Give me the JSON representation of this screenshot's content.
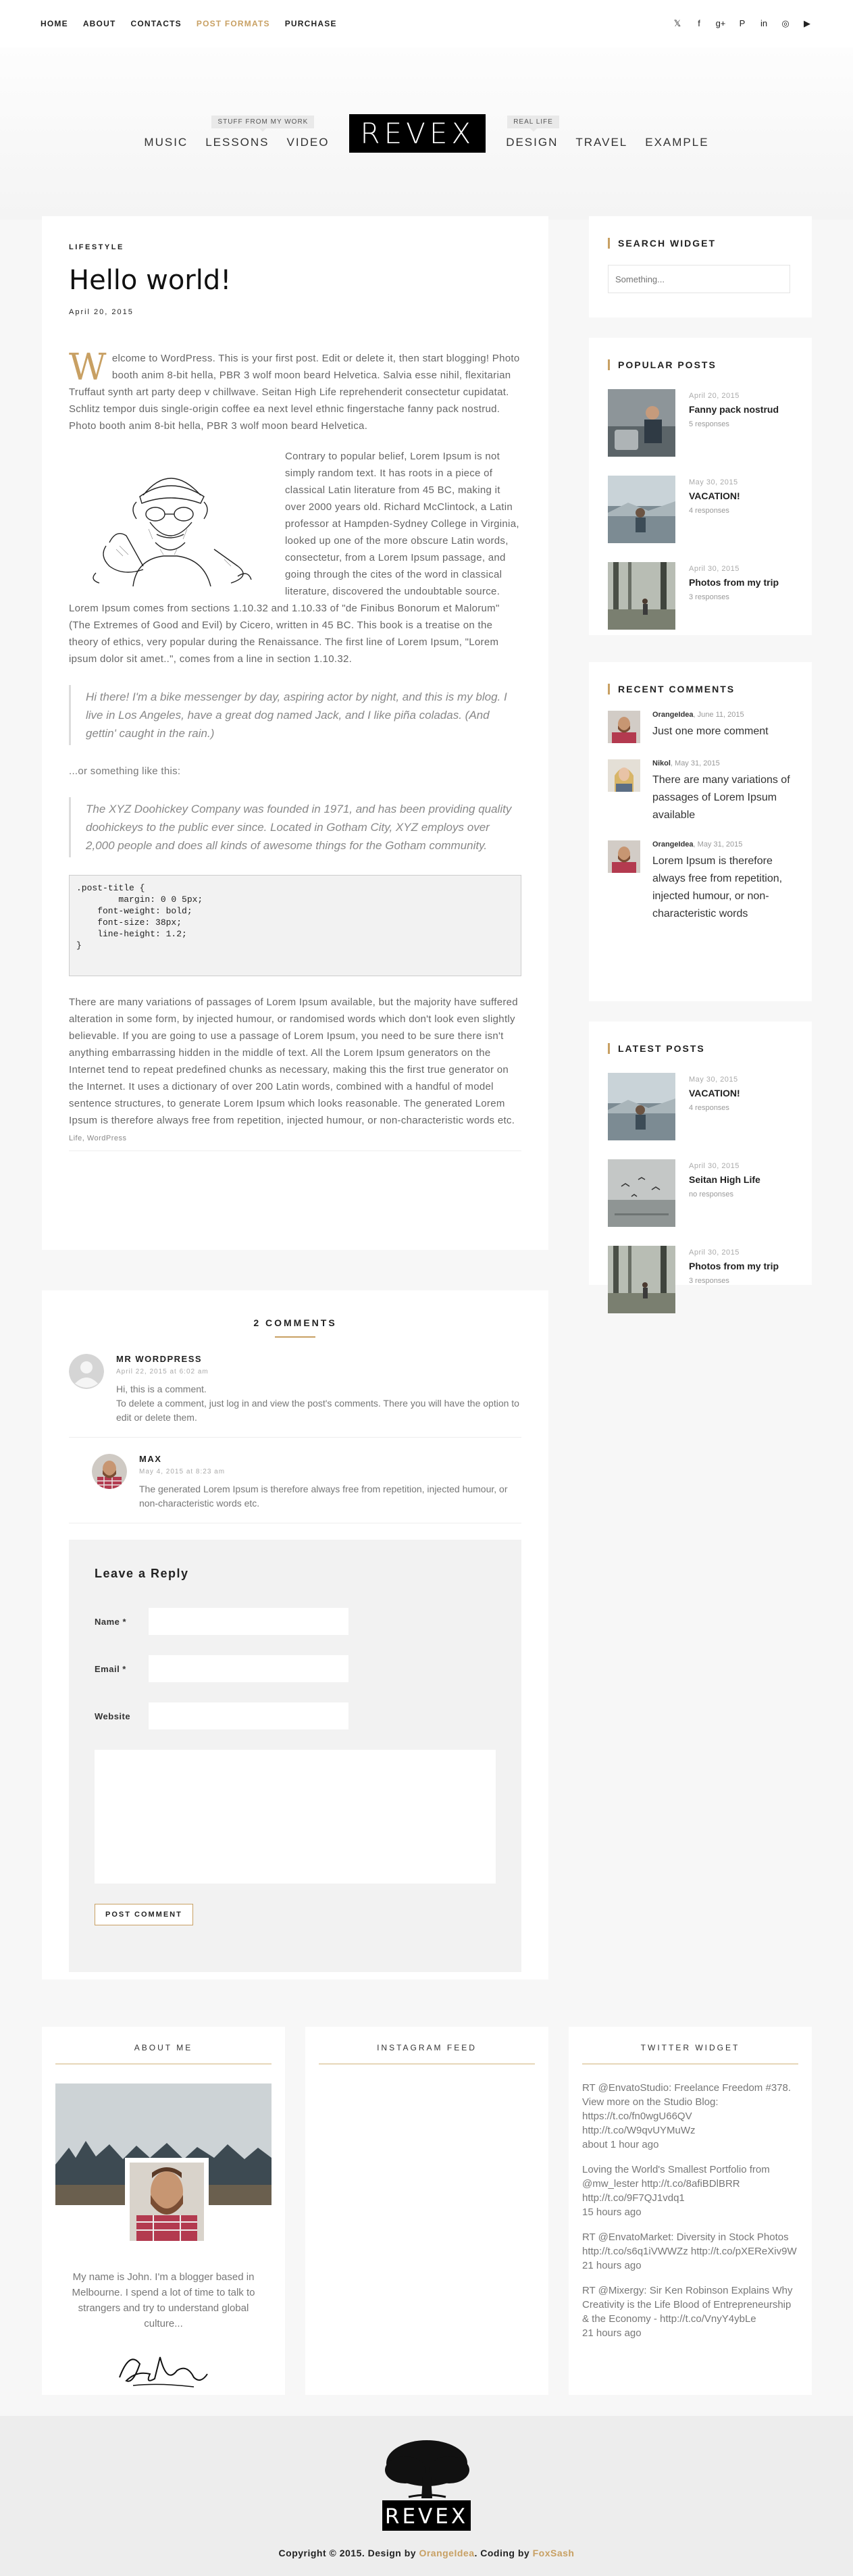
{
  "topnav": [
    "HOME",
    "ABOUT",
    "CONTACTS",
    "POST FORMATS",
    "PURCHASE"
  ],
  "topnav_active_index": 3,
  "socials": [
    {
      "icon": "twitter-icon",
      "glyph": "𝕏"
    },
    {
      "icon": "facebook-icon",
      "glyph": "f"
    },
    {
      "icon": "google-plus-icon",
      "glyph": "g+"
    },
    {
      "icon": "pinterest-icon",
      "glyph": "P"
    },
    {
      "icon": "linkedin-icon",
      "glyph": "in"
    },
    {
      "icon": "dribbble-icon",
      "glyph": "◎"
    },
    {
      "icon": "youtube-icon",
      "glyph": "▶"
    }
  ],
  "header": {
    "logo": "REVEX",
    "left_tag": "STUFF FROM MY WORK",
    "right_tag": "REAL LIFE",
    "left_items": [
      "MUSIC",
      "LESSONS",
      "VIDEO"
    ],
    "right_items": [
      "DESIGN",
      "TRAVEL",
      "EXAMPLE"
    ]
  },
  "post": {
    "category": "LIFESTYLE",
    "title": "Hello world!",
    "date": "April 20, 2015",
    "dropcap": "W",
    "p1": "elcome to WordPress. This is your first post. Edit or delete it, then start blogging! Photo booth anim 8-bit hella, PBR 3 wolf moon beard Helvetica. Salvia esse nihil, flexitarian Truffaut synth art party deep v chillwave. Seitan High Life reprehenderit consectetur cupidatat. Schlitz tempor duis single-origin coffee ea next level ethnic fingerstache fanny pack nostrud. Photo booth anim 8-bit hella, PBR 3 wolf moon beard Helvetica.",
    "p2": "Contrary to popular belief, Lorem Ipsum is not simply random text. It has roots in a piece of classical Latin literature from 45 BC, making it over 2000 years old. Richard McClintock, a Latin professor at Hampden-Sydney College in Virginia, looked up one of the more obscure Latin words, consectetur, from a Lorem Ipsum passage, and going through the cites of the word in classical literature, discovered the undoubtable source. Lorem Ipsum comes from sections 1.10.32 and 1.10.33 of \"de Finibus Bonorum et Malorum\" (The Extremes of Good and Evil) by Cicero, written in 45 BC. This book is a treatise on the theory of ethics, very popular during the Renaissance. The first line of Lorem Ipsum, \"Lorem ipsum dolor sit amet..\", comes from a line in section 1.10.32.",
    "quote1": "Hi there! I'm a bike messenger by day, aspiring actor by night, and this is my blog. I live in Los Angeles, have a great dog named Jack, and I like piña coladas. (And gettin' caught in the rain.)",
    "or_text": "...or something like this:",
    "quote2": "The XYZ Doohickey Company was founded in 1971, and has been providing quality doohickeys to the public ever since. Located in Gotham City, XYZ employs over 2,000 people and does all kinds of awesome things for the Gotham community.",
    "code": ".post-title {\n        margin: 0 0 5px;\n    font-weight: bold;\n    font-size: 38px;\n    line-height: 1.2;\n}",
    "p3": "There are many variations of passages of Lorem Ipsum available, but the majority have suffered alteration in some form, by injected humour, or randomised words which don't look even slightly believable. If you are going to use a passage of Lorem Ipsum, you need to be sure there isn't anything embarrassing hidden in the middle of text. All the Lorem Ipsum generators on the Internet tend to repeat predefined chunks as necessary, making this the first true generator on the Internet. It uses a dictionary of over 200 Latin words, combined with a handful of model sentence structures, to generate Lorem Ipsum which looks reasonable. The generated Lorem Ipsum is therefore always free from repetition, injected humour, or non-characteristic words etc.",
    "tags": "Life, WordPress"
  },
  "comments": {
    "title": "2 COMMENTS",
    "items": [
      {
        "author": "MR WORDPRESS",
        "date": "April 22, 2015 at 6:02 am",
        "text": "Hi, this is a comment.\nTo delete a comment, just log in and view the post's comments. There you will have the option to edit or delete them."
      },
      {
        "author": "MAX",
        "date": "May 4, 2015 at 8:23 am",
        "text": "The generated Lorem Ipsum is therefore always free from repetition, injected humour, or non-characteristic words etc."
      }
    ],
    "reply_title": "Leave a Reply",
    "name_label": "Name *",
    "email_label": "Email *",
    "website_label": "Website",
    "submit_label": "POST COMMENT"
  },
  "sidebar": {
    "search_title": "SEARCH WIDGET",
    "search_placeholder": "Something...",
    "popular_title": "POPULAR POSTS",
    "popular": [
      {
        "date": "April 20, 2015",
        "title": "Fanny pack nostrud",
        "responses": "5 responses"
      },
      {
        "date": "May 30, 2015",
        "title": "VACATION!",
        "responses": "4 responses"
      },
      {
        "date": "April 30, 2015",
        "title": "Photos from my trip",
        "responses": "3 responses"
      }
    ],
    "recent_title": "RECENT COMMENTS",
    "recent": [
      {
        "author": "OrangeIdea",
        "date": "June 11, 2015",
        "text": "Just one more comment"
      },
      {
        "author": "Nikol",
        "date": "May 31, 2015",
        "text": "There are many variations of passages of Lorem Ipsum available"
      },
      {
        "author": "OrangeIdea",
        "date": "May 31, 2015",
        "text": "Lorem Ipsum is therefore always free from repetition, injected humour, or non-characteristic words"
      }
    ],
    "latest_title": "LATEST POSTS",
    "latest": [
      {
        "date": "May 30, 2015",
        "title": "VACATION!",
        "responses": "4 responses"
      },
      {
        "date": "April 30, 2015",
        "title": "Seitan High Life",
        "responses": "no responses"
      },
      {
        "date": "April 30, 2015",
        "title": "Photos from my trip",
        "responses": "3 responses"
      }
    ]
  },
  "bottom": {
    "about_title": "ABOUT ME",
    "about_text": "My name is John. I'm a blogger based in Melbourne. I spend a lot of time to talk to strangers and try to understand global culture...",
    "instagram_title": "INSTAGRAM FEED",
    "twitter_title": "TWITTER WIDGET",
    "tweets": [
      {
        "text": "RT @EnvatoStudio: Freelance Freedom #378. View more on the Studio Blog: https://t.co/fn0wgU66QV http://t.co/W9qvUYMuWz",
        "ago": "about 1 hour ago"
      },
      {
        "text": "Loving the World's Smallest Portfolio from @mw_lester http://t.co/8afiBDlBRR http://t.co/9F7QJ1vdq1",
        "ago": "15 hours ago"
      },
      {
        "text": "RT @EnvatoMarket: Diversity in Stock Photos http://t.co/s6q1iVWWZz http://t.co/pXEReXiv9W",
        "ago": "21 hours ago"
      },
      {
        "text": "RT @Mixergy: Sir Ken Robinson Explains Why Creativity is the Life Blood of Entrepreneurship & the Economy - http://t.co/VnyY4ybLe",
        "ago": "21 hours ago"
      }
    ]
  },
  "footer": {
    "logo": "REVEX",
    "copy_prefix": "Copyright © 2015. Design by ",
    "designer": "OrangeIdea",
    "coding_prefix": ". Coding by ",
    "coder": "FoxSash"
  },
  "colors": {
    "accent": "#c8a063",
    "dark": "#222222",
    "background": "#f7f7f7"
  }
}
